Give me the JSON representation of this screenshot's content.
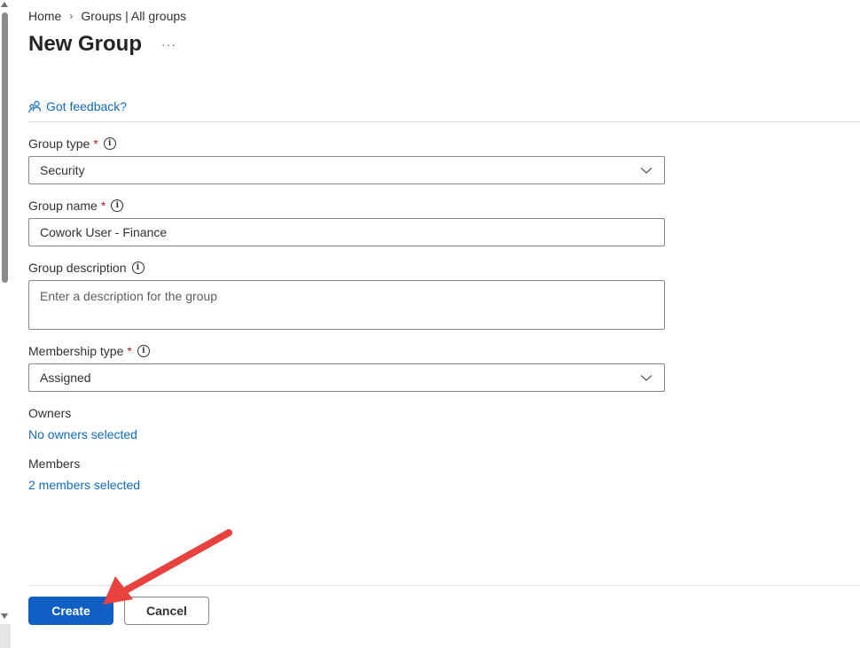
{
  "breadcrumb": {
    "home": "Home",
    "separator": "›",
    "groups": "Groups | All groups"
  },
  "page": {
    "title": "New Group",
    "more": "···"
  },
  "feedback": {
    "label": "Got feedback?",
    "icon": "feedback-people-icon"
  },
  "form": {
    "group_type": {
      "label": "Group type",
      "required": "*",
      "value": "Security"
    },
    "group_name": {
      "label": "Group name",
      "required": "*",
      "value": "Cowork User - Finance"
    },
    "group_description": {
      "label": "Group description",
      "placeholder": "Enter a description for the group"
    },
    "membership_type": {
      "label": "Membership type",
      "required": "*",
      "value": "Assigned"
    },
    "owners": {
      "label": "Owners",
      "link": "No owners selected"
    },
    "members": {
      "label": "Members",
      "link": "2 members selected"
    }
  },
  "actions": {
    "create": "Create",
    "cancel": "Cancel"
  },
  "colors": {
    "link": "#0f6cbd",
    "primary": "#0f5fc4",
    "required": "#a4262c",
    "annotation_arrow": "#e8423f"
  }
}
